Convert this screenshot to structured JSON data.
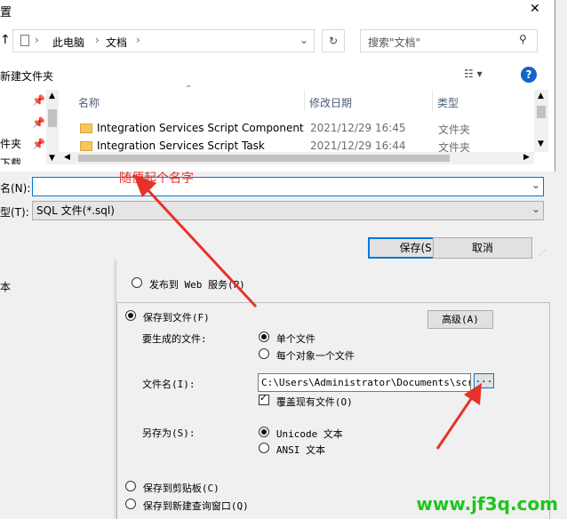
{
  "dialog": {
    "title_fragment": "置",
    "close_glyph": "✕",
    "breadcrumb": [
      "此电脑",
      "文档"
    ],
    "search_placeholder": "搜索\"文档\"",
    "new_folder": "新建文件夹",
    "help_glyph": "?",
    "columns": {
      "name": "名称",
      "date": "修改日期",
      "type": "类型"
    },
    "nav_items": [
      "件夹",
      "下载"
    ],
    "rows": [
      {
        "name": "Integration Services Script Component",
        "date": "2021/12/29 16:45",
        "type": "文件夹"
      },
      {
        "name": "Integration Services Script Task",
        "date": "2021/12/29 16:44",
        "type": "文件夹"
      }
    ],
    "filename_label": "名(N):",
    "filename_value": "",
    "filetype_label": "型(T):",
    "filetype_value": "SQL 文件(*.sql)",
    "save_button": "保存(S)",
    "cancel_button": "取消"
  },
  "annotation": {
    "note": "随便起个名字",
    "color": "#e8312a"
  },
  "wizard": {
    "left_text": "本",
    "publish_web": "发布到 Web 服务(P)",
    "save_to_file": "保存到文件(F)",
    "advanced_button": "高级(A)",
    "files_to_generate_label": "要生成的文件:",
    "single_file": "单个文件",
    "file_per_object": "每个对象一个文件",
    "filename_label": "文件名(I):",
    "filename_value": "C:\\Users\\Administrator\\Documents\\script",
    "browse_button": "...",
    "overwrite": "覆盖现有文件(O)",
    "save_as_label": "另存为(S):",
    "unicode_text": "Unicode 文本",
    "ansi_text": "ANSI 文本",
    "save_to_clipboard": "保存到剪贴板(C)",
    "save_to_query_window": "保存到新建查询窗口(Q)"
  },
  "watermark": "www.jf3q.com"
}
